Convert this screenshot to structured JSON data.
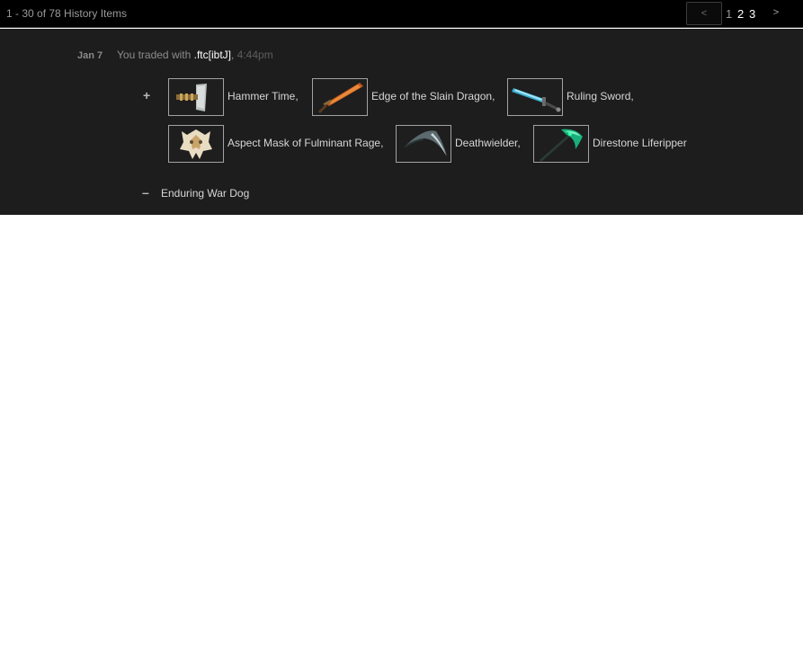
{
  "header": {
    "count_text": "1 - 30 of 78 History Items",
    "pagination": {
      "prev_label": "<",
      "next_label": ">",
      "pages": [
        "1",
        "2",
        "3"
      ]
    }
  },
  "entry": {
    "date": "Jan 7",
    "prefix": "You traded with",
    "partner": ".ftc[ibtJ]",
    "separator": ",",
    "time": "4:44pm",
    "received_sign": "+",
    "given_sign": "–",
    "received_items": [
      {
        "name": "Hammer Time,",
        "icon": "hammer-item-icon"
      },
      {
        "name": "Edge of the Slain Dragon,",
        "icon": "dragon-sword-item-icon"
      },
      {
        "name": "Ruling Sword,",
        "icon": "ruling-sword-item-icon"
      },
      {
        "name": "Aspect Mask of Fulminant Rage,",
        "icon": "mask-item-icon"
      },
      {
        "name": "Deathwielder,",
        "icon": "scythe-item-icon"
      },
      {
        "name": "Direstone Liferipper",
        "icon": "green-scythe-item-icon"
      }
    ],
    "given_items": [
      {
        "name": "Enduring War Dog"
      }
    ]
  }
}
